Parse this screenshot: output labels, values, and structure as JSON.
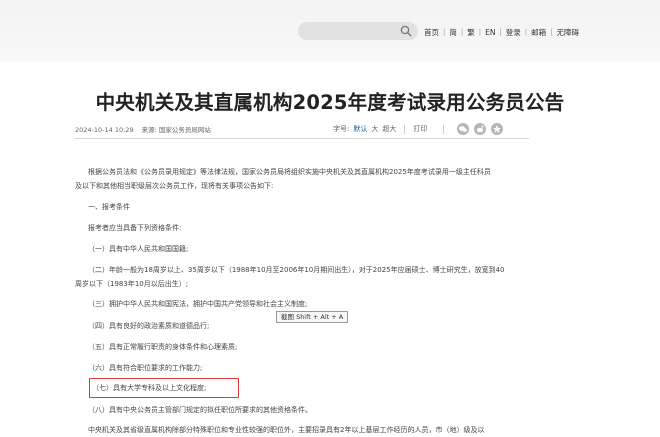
{
  "nav": {
    "search_placeholder": "",
    "items": [
      "首页",
      "简",
      "繁",
      "EN",
      "登录",
      "邮箱",
      "无障碍"
    ]
  },
  "article": {
    "title": "中央机关及其直属机构2025年度考试录用公务员公告",
    "date": "2024-10-14 10:29",
    "source": "来源: 国家公务员局网站",
    "font_label": "字号:",
    "font_current": "默认",
    "font_large": "大",
    "font_xlarge": "超大",
    "print_label": "打印"
  },
  "body": {
    "p1_line1": "根据公务员法和《公务员录用规定》等法律法规，国家公务员局将组织实施中央机关及其直属机构2025年度考试录用一级主任科员",
    "p1_line2": "及以下和其他相当职级层次公务员工作，现将有关事项公告如下:",
    "section1": "一、报考条件",
    "intro": "报考者应当具备下列资格条件:",
    "c1": "（一）具有中华人民共和国国籍;",
    "c2_line1": "（二）年龄一般为18周岁以上、35周岁以下（1988年10月至2006年10月期间出生），对于2025年应届硕士、博士研究生，放宽到40",
    "c2_line2": "周岁以下（1983年10月以后出生）;",
    "c3": "（三）拥护中华人民共和国宪法，拥护中国共产党领导和社会主义制度;",
    "c4": "（四）具有良好的政治素质和道德品行;",
    "c5": "（五）具有正常履行职责的身体条件和心理素质;",
    "c6": "（六）具有符合职位要求的工作能力;",
    "c7": "（七）具有大学专科及以上文化程度;",
    "c8": "（八）具有中央公务员主管部门规定的拟任职位所要求的其他资格条件。",
    "p_last": "中央机关及其省级直属机构除部分特殊职位和专业性较强的职位外，主要招录具有2年以上基层工作经历的人员，市（地）级及以"
  },
  "tooltip": "截图 Shift + Alt + A",
  "colors": {
    "highlight_border": "#e03a3a",
    "link_blue": "#1a57a8"
  }
}
